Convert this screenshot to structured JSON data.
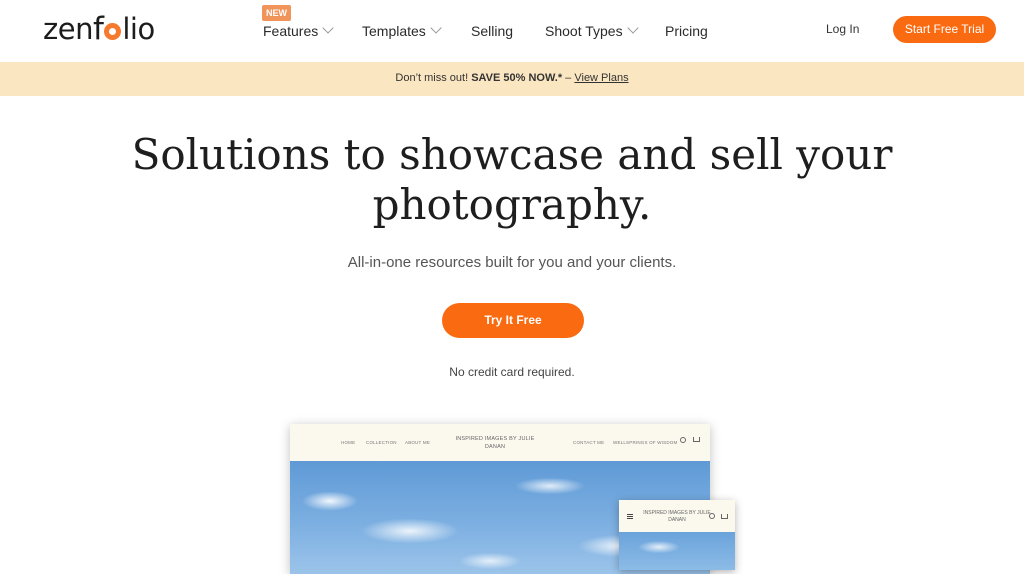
{
  "brand": {
    "logo_text_before": "zen",
    "logo_text_after": "lio"
  },
  "nav": {
    "badge": "NEW",
    "items": [
      {
        "label": "Features",
        "dropdown": true
      },
      {
        "label": "Templates",
        "dropdown": true
      },
      {
        "label": "Selling",
        "dropdown": false
      },
      {
        "label": "Shoot Types",
        "dropdown": true
      },
      {
        "label": "Pricing",
        "dropdown": false
      }
    ],
    "login": "Log In",
    "cta": "Start Free Trial"
  },
  "promo": {
    "lead": "Don’t miss out!",
    "offer": "SAVE 50% NOW.*",
    "sep": "–",
    "link": "View Plans"
  },
  "hero": {
    "title": "Solutions to showcase and sell your photography.",
    "subtitle": "All-in-one resources built for you and your clients.",
    "cta": "Try It Free",
    "note": "No credit card required."
  },
  "preview": {
    "nav": [
      "HOME",
      "COLLECTION",
      "ABOUT ME"
    ],
    "brand": "INSPIRED IMAGES BY JULIE DANAN",
    "nav_right": [
      "CONTACT ME",
      "WELLSPRINGS OF WISDOM"
    ],
    "mobile_brand": "INSPIRED IMAGES BY JULIE DANAN"
  },
  "colors": {
    "accent": "#fa6a10",
    "promo_bg": "#fbe6c2",
    "badge": "#f0945a"
  }
}
